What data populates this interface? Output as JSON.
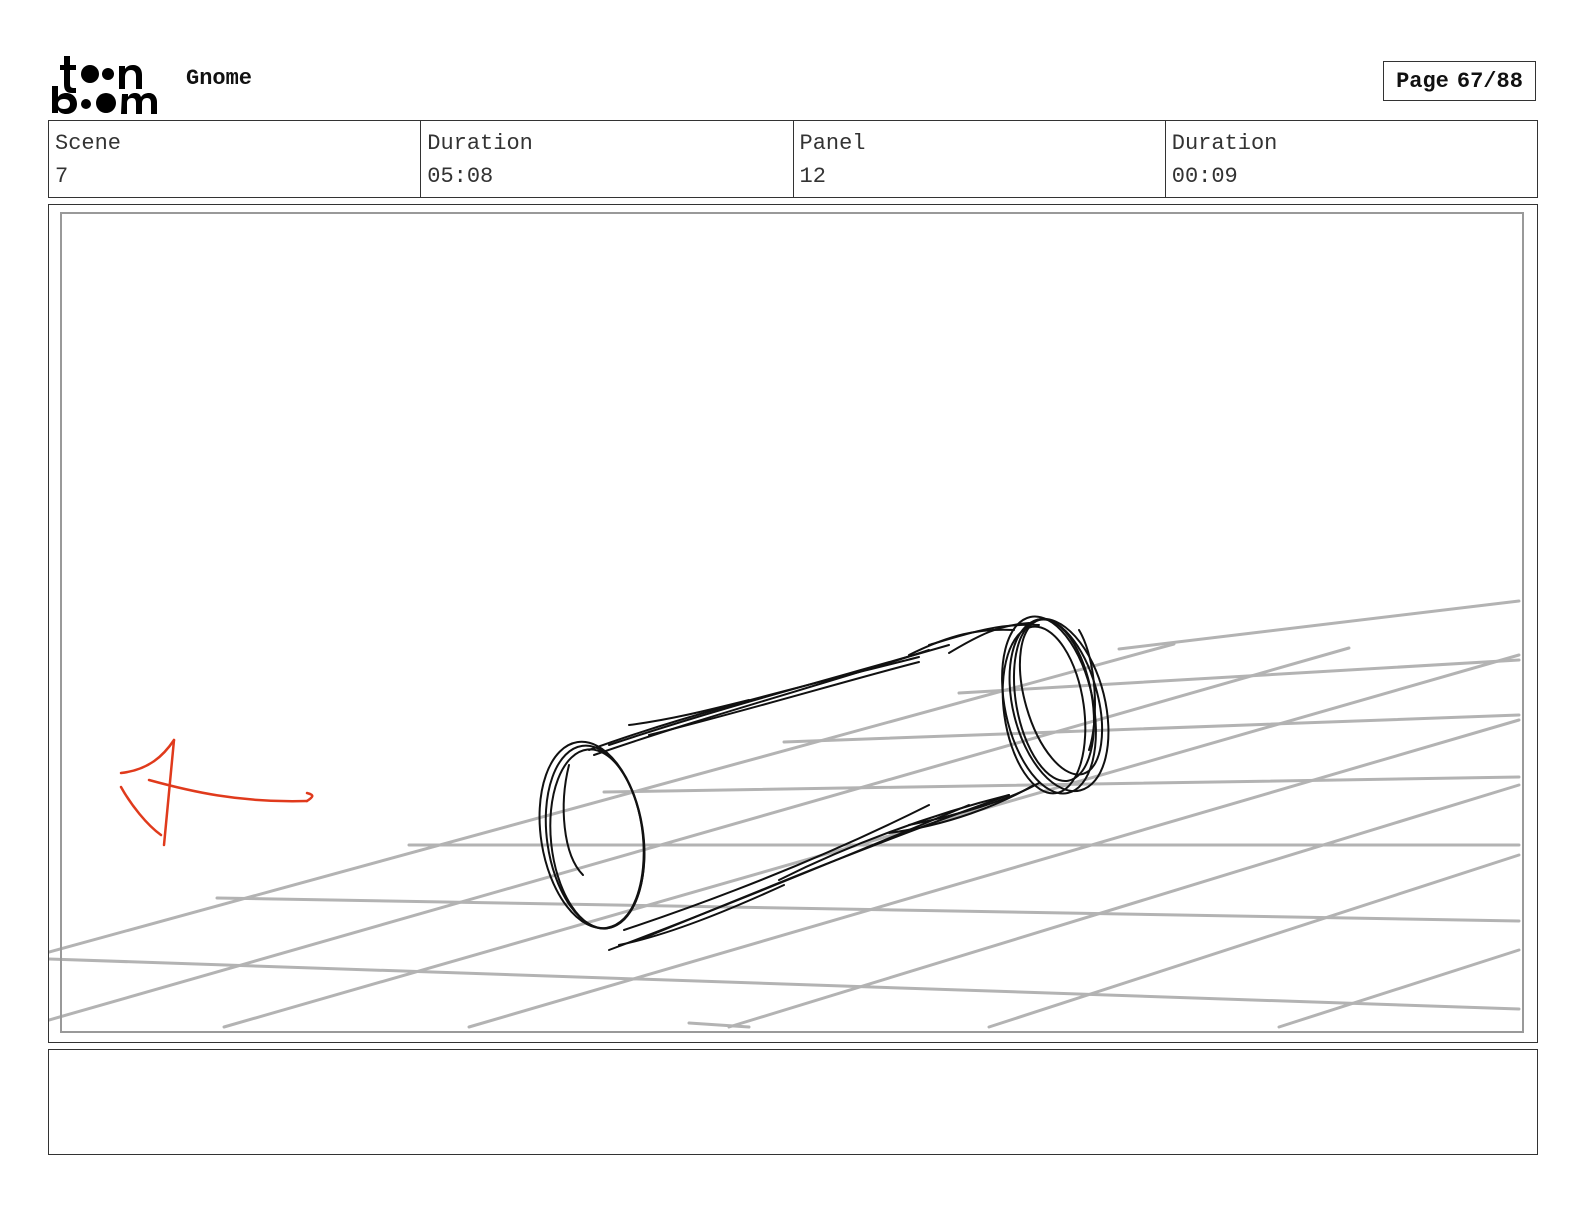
{
  "header": {
    "logo_top": "t••n",
    "logo_bottom": "b••m",
    "project_title": "Gnome",
    "page_label": "Page",
    "page_number": "67/88"
  },
  "info": {
    "scene_label": "Scene",
    "scene_value": "7",
    "scene_duration_label": "Duration",
    "scene_duration_value": "05:08",
    "panel_label": "Panel",
    "panel_value": "12",
    "panel_duration_label": "Duration",
    "panel_duration_value": "00:09"
  },
  "notes": {
    "text": ""
  },
  "colors": {
    "frame": "#333333",
    "grid": "#b3b3b3",
    "sketch": "#111111",
    "arrow": "#e03a1c"
  }
}
